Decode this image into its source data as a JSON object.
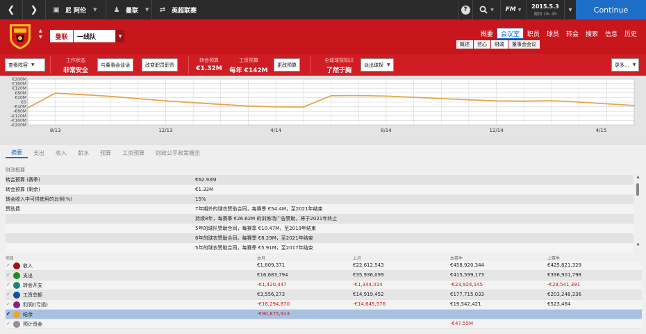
{
  "topbar": {
    "manager": "尼 阿伦",
    "club": "曼联",
    "competition": "英超联赛",
    "help_icon": "?",
    "search_icon": "search-icon",
    "fm_label": "FM",
    "date": "2015.5.3",
    "day": "周日 16: 45",
    "continue": "Continue"
  },
  "club_header": {
    "club_name": "曼联",
    "squad": "一线队",
    "tabs": [
      "概要",
      "会议室",
      "职员",
      "球员",
      "转会",
      "搜索",
      "信息",
      "历史"
    ],
    "active_tab": 1,
    "subtabs": [
      "概述",
      "信心",
      "财政",
      "董事会会议"
    ],
    "active_subtab": 2,
    "colors": {
      "club_red": "#c8161d",
      "accent_blue": "#1d6ec6"
    }
  },
  "infobar": {
    "view_lineup": "查看阵容",
    "work_status_label": "工作状态",
    "work_status_value": "非常安全",
    "talk_board": "与董事会谈话",
    "change_staff": "改变职员职责",
    "transfer_budget_label": "转会预算",
    "transfer_budget_value": "€1.32M",
    "wage_budget_label": "工资预算",
    "wage_budget_value": "每年 €142M",
    "change_budget": "更改预算",
    "scout_knowledge_label": "全球球探知识",
    "scout_knowledge_value": "了然于胸",
    "send_scout": "派出球探",
    "more": "更多..."
  },
  "chart_data": {
    "type": "line",
    "ylabels": [
      "€200M",
      "€160M",
      "€120M",
      "€80M",
      "€40M",
      "€0",
      "-€40M",
      "-€80M",
      "-€120M",
      "-€160M",
      "-€200M"
    ],
    "xlabels": [
      "8/13",
      "12/13",
      "4/14",
      "8/14",
      "12/14",
      "4/15"
    ],
    "ylim": [
      -200,
      200
    ],
    "yunit": "€M",
    "series": [
      {
        "x": [
          "2013-07-01",
          "2013-08-01",
          "2013-09-01",
          "2013-10-01",
          "2013-11-01",
          "2013-12-01",
          "2014-01-01",
          "2014-02-01",
          "2014-03-01",
          "2014-04-01",
          "2014-05-01",
          "2014-06-01",
          "2014-07-01",
          "2014-08-01",
          "2014-09-01",
          "2014-10-01",
          "2014-11-01",
          "2014-12-01",
          "2015-01-01",
          "2015-02-01",
          "2015-03-01",
          "2015-04-01",
          "2015-05-01"
        ],
        "values": [
          -50,
          78,
          65,
          50,
          30,
          10,
          -5,
          -20,
          -35,
          -42,
          -43,
          55,
          57,
          52,
          42,
          30,
          20,
          10,
          8,
          12,
          0,
          -15,
          -30
        ],
        "color": "#e0a84a"
      }
    ],
    "grid": true
  },
  "tabs": [
    "摘要",
    "支出",
    "收入",
    "薪水",
    "预算",
    "工资预算",
    "财政公平政策概览"
  ],
  "active_tab": 0,
  "section_title": "财政概要",
  "summary_rows": [
    {
      "key": "转会预算 (赛季)",
      "value": "€62.93M"
    },
    {
      "key": "转会预算 (剩余)",
      "value": "€1.32M"
    },
    {
      "key": "转会收入中可供使用的比例(%)",
      "value": "15%"
    },
    {
      "key": "赞助费",
      "value": "7年期外的球衣赞助合同，每赛季 €54.4M，至2021年结束"
    },
    {
      "key": "",
      "value": "持续8年，每赛季 €26.62M 的训练场广告赞助，将于2021年终止"
    },
    {
      "key": "",
      "value": "5年的球队赞助合同，每赛季 €10.47M，至2019年结束"
    },
    {
      "key": "",
      "value": "6年的球衣赞助合同，每赛季 €8.29M，至2021年结束"
    },
    {
      "key": "",
      "value": "5年的球衣赞助合同，每赛季 €5.91M，至2017年结束"
    }
  ],
  "finance_table": {
    "headers": [
      "项目",
      "本月",
      "上月",
      "本赛季",
      "上赛季"
    ],
    "rows": [
      {
        "name": "收入",
        "color": "#a11313",
        "v": [
          "€1,809,371",
          "€22,612,543",
          "€458,920,344",
          "€425,821,329"
        ],
        "neg": [
          false,
          false,
          false,
          false
        ]
      },
      {
        "name": "支出",
        "color": "#16921b",
        "v": [
          "€16,683,794",
          "€35,936,099",
          "€415,599,173",
          "€396,901,798"
        ],
        "neg": [
          false,
          false,
          false,
          false
        ]
      },
      {
        "name": "转会开支",
        "color": "#12877f",
        "v": [
          "-€1,420,447",
          "-€1,344,014",
          "-€23,924,145",
          "-€28,541,391"
        ],
        "neg": [
          true,
          true,
          true,
          true
        ]
      },
      {
        "name": "工资总额",
        "color": "#174b9b",
        "v": [
          "€3,556,273",
          "€14,919,452",
          "€177,715,033",
          "€203,248,336"
        ],
        "neg": [
          false,
          false,
          false,
          false
        ]
      },
      {
        "name": "利润/(亏损)",
        "color": "#8e1a8f",
        "v": [
          "-€16,294,870",
          "-€14,649,576",
          "€19,542,421",
          "€523,464"
        ],
        "neg": [
          true,
          true,
          false,
          false
        ]
      },
      {
        "name": "结余",
        "color": "#f2a715",
        "v": [
          "-€90,875,913",
          "",
          "",
          ""
        ],
        "neg": [
          true,
          false,
          false,
          false
        ],
        "selected": true
      },
      {
        "name": "预计资金",
        "color": "#9c8c8c",
        "v": [
          "",
          "",
          "-€47.55M",
          ""
        ],
        "neg": [
          false,
          false,
          true,
          false
        ]
      }
    ]
  }
}
